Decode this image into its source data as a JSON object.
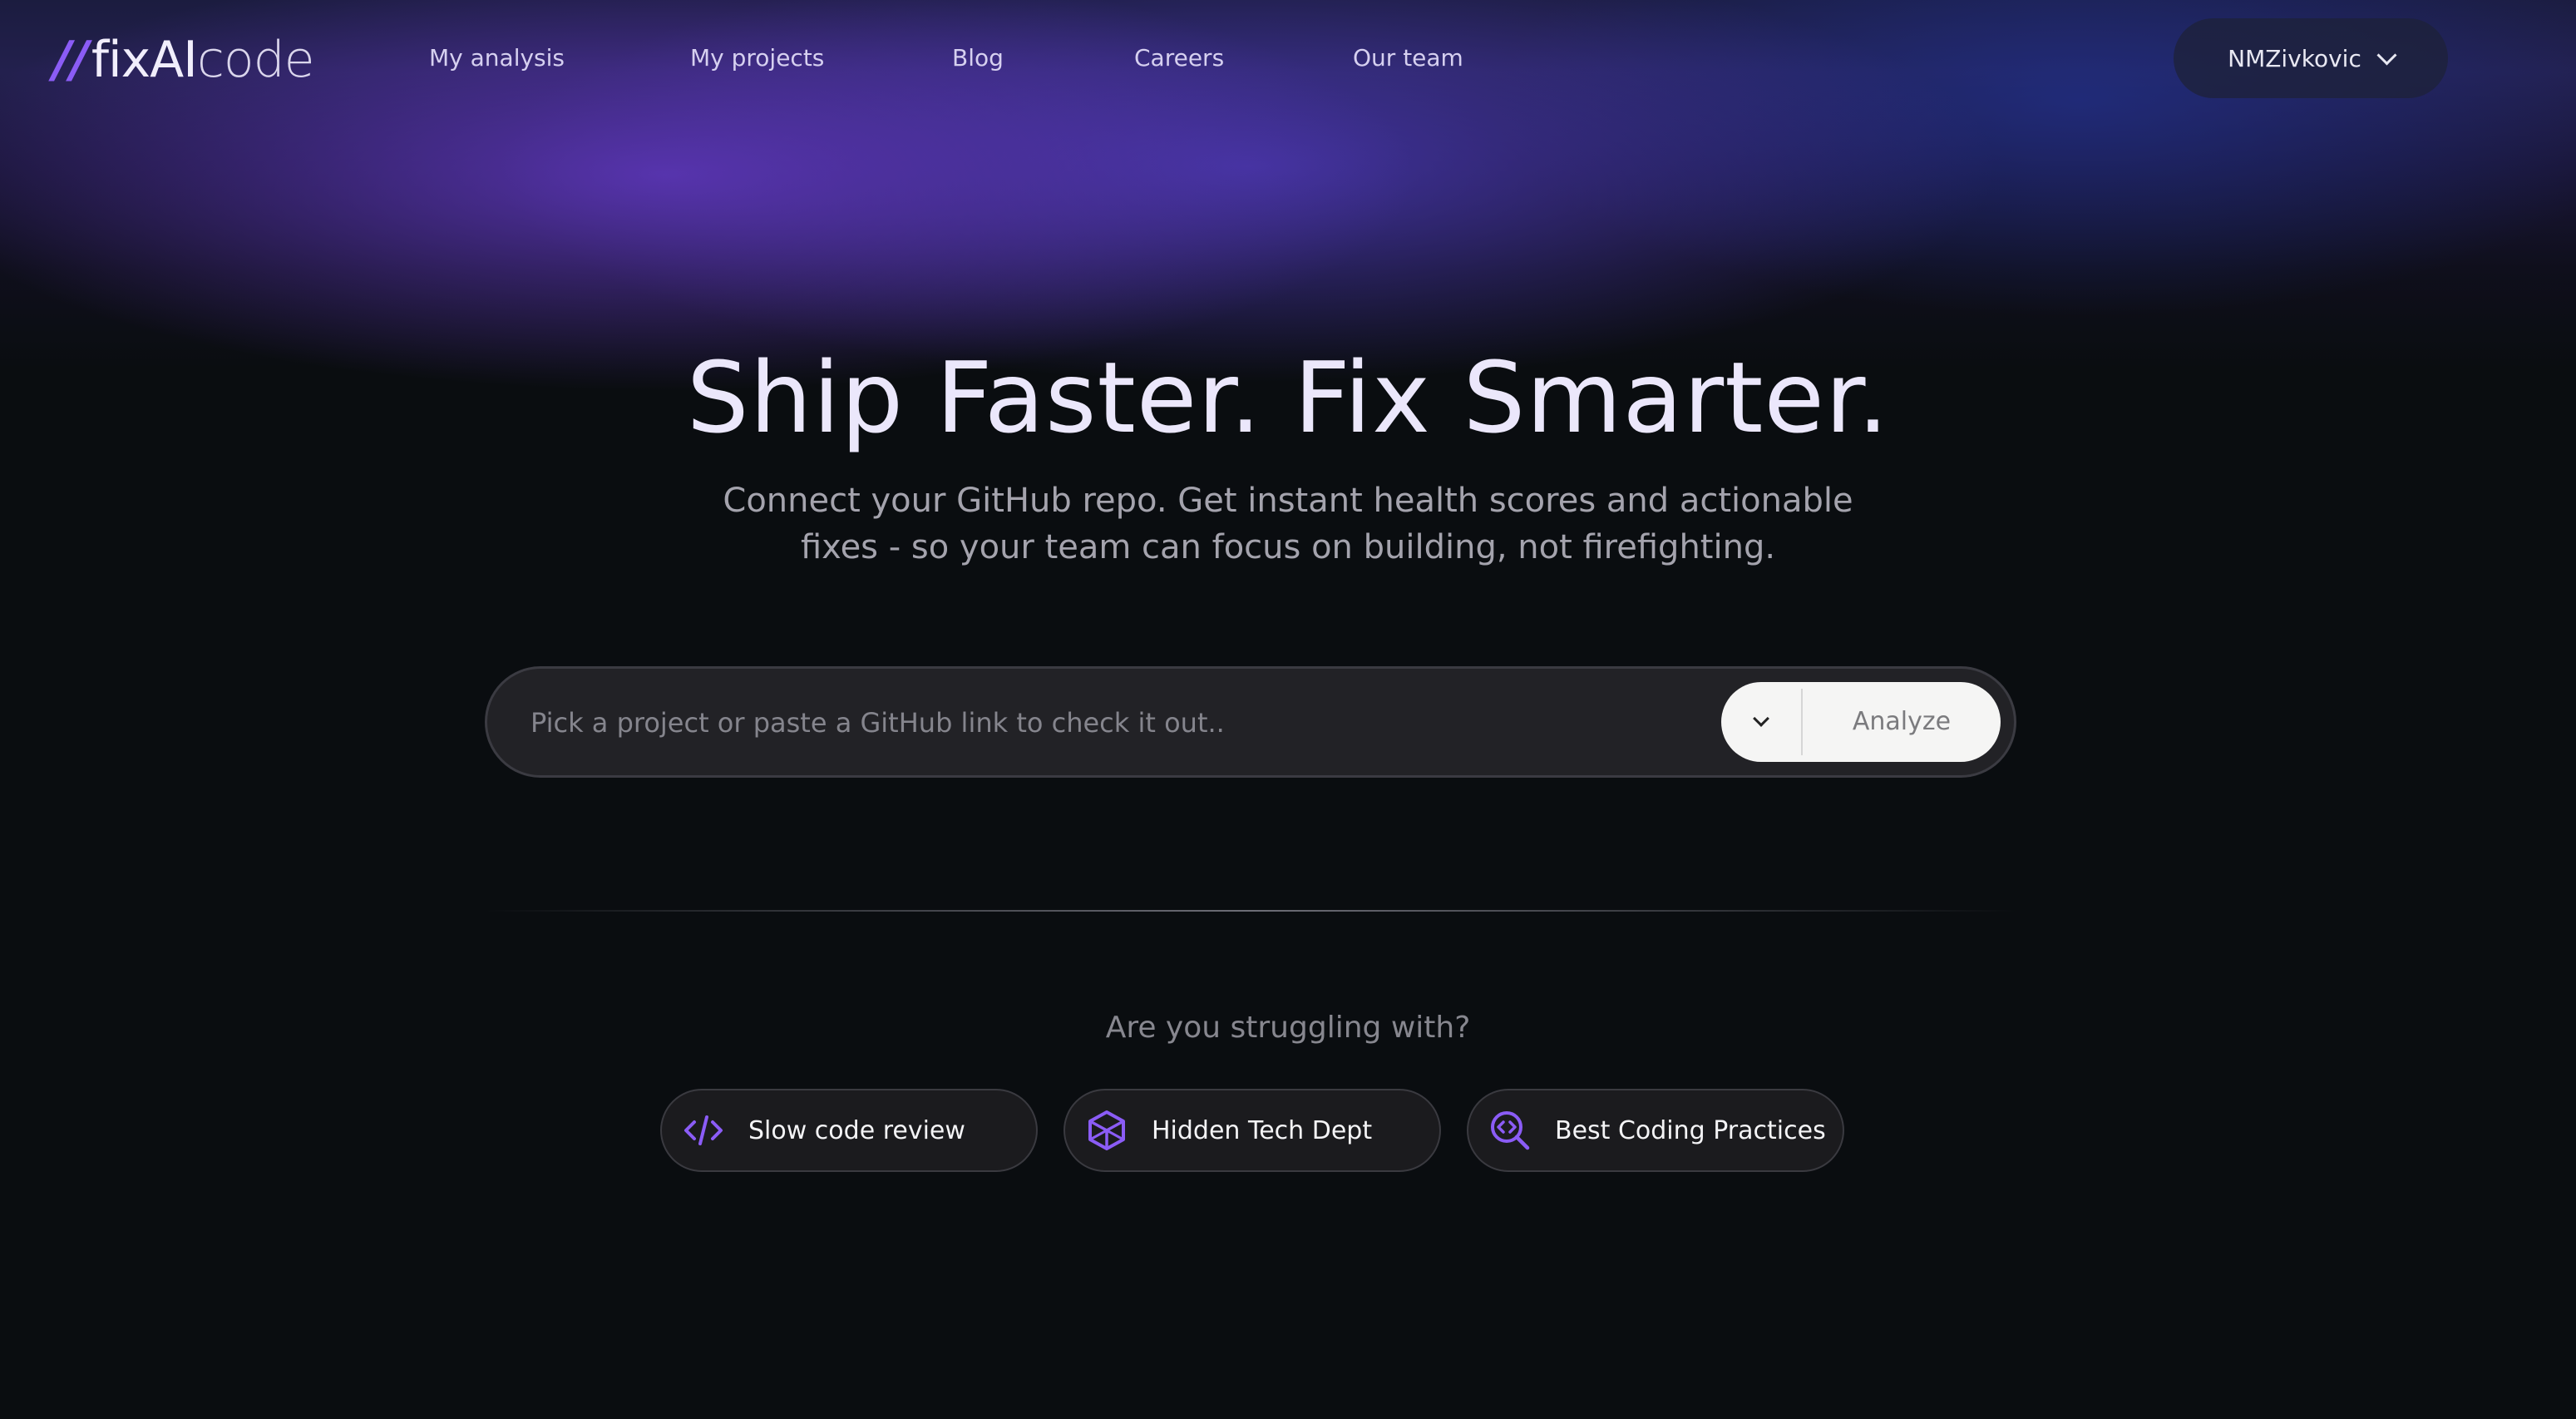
{
  "brand": {
    "slashes": "//",
    "name_primary": "fixAI",
    "name_secondary": "code",
    "accent_color": "#8b5cf6"
  },
  "nav": {
    "links": [
      {
        "label": "My analysis"
      },
      {
        "label": "My projects"
      },
      {
        "label": "Blog"
      },
      {
        "label": "Careers"
      },
      {
        "label": "Our team"
      }
    ],
    "user": {
      "name": "NMZivkovic",
      "icon": "chevron-down-icon"
    }
  },
  "hero": {
    "title": "Ship Faster. Fix Smarter.",
    "subtitle_line1": "Connect your GitHub repo. Get instant health scores and actionable",
    "subtitle_line2": "fixes - so your team can focus on building, not firefighting."
  },
  "search": {
    "placeholder": "Pick a project or paste a GitHub link to check it out..",
    "value": "",
    "dropdown_icon": "chevron-down-icon",
    "analyze_label": "Analyze"
  },
  "struggle": {
    "heading": "Are you struggling with?",
    "items": [
      {
        "label": "Slow code review",
        "icon": "code-icon"
      },
      {
        "label": "Hidden Tech Dept",
        "icon": "cube-icon"
      },
      {
        "label": "Best Coding Practices",
        "icon": "search-code-icon"
      }
    ]
  }
}
